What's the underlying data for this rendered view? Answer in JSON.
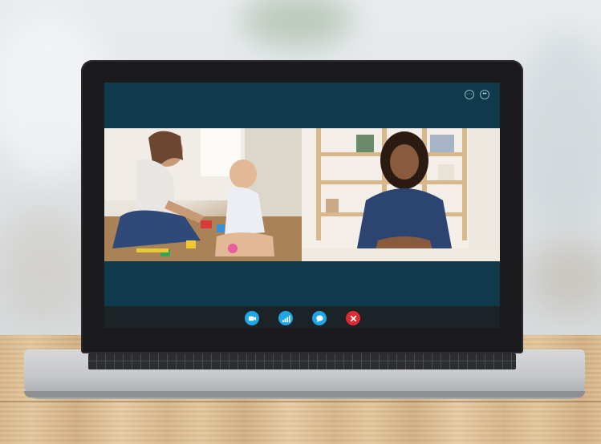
{
  "scene": {
    "description_free": true
  },
  "screen": {
    "background_color": "#0e3a4c",
    "top_controls": [
      {
        "icon": "ellipsis-icon",
        "glyph": "···"
      },
      {
        "icon": "dual-dot-icon",
        "glyph": "••"
      }
    ],
    "participants": [
      {
        "tile": "left",
        "icon": "video-feed"
      },
      {
        "tile": "right",
        "icon": "video-feed"
      }
    ],
    "control_bar": {
      "background": "#1b2327",
      "buttons": [
        {
          "icon": "video-camera-icon",
          "color": "#1ea7e4"
        },
        {
          "icon": "signal-icon",
          "color": "#1ea7e4"
        },
        {
          "icon": "chat-bubble-icon",
          "color": "#1ea7e4"
        },
        {
          "icon": "end-call-icon",
          "color": "#e02a2f"
        }
      ]
    }
  }
}
